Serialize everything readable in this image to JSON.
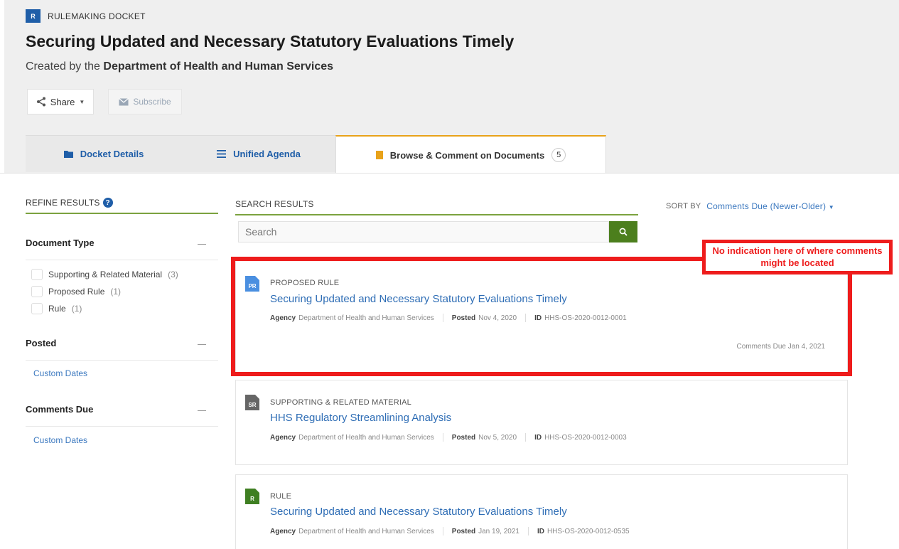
{
  "header": {
    "docket_badge": "R",
    "docket_label": "RULEMAKING DOCKET",
    "title": "Securing Updated and Necessary Statutory Evaluations Timely",
    "created_prefix": "Created by the",
    "created_by": "Department of Health and Human Services",
    "share_label": "Share",
    "subscribe_label": "Subscribe"
  },
  "tabs": [
    {
      "label": "Docket Details",
      "icon": "folder-icon"
    },
    {
      "label": "Unified Agenda",
      "icon": "list-icon"
    },
    {
      "label": "Browse & Comment on Documents",
      "icon": "document-icon",
      "count": "5",
      "active": true
    }
  ],
  "refine": {
    "title": "REFINE RESULTS",
    "document_type": {
      "heading": "Document Type",
      "options": [
        {
          "label": "Supporting & Related Material",
          "count": "(3)"
        },
        {
          "label": "Proposed Rule",
          "count": "(1)"
        },
        {
          "label": "Rule",
          "count": "(1)"
        }
      ]
    },
    "posted": {
      "heading": "Posted",
      "link": "Custom Dates"
    },
    "comments_due": {
      "heading": "Comments Due",
      "link": "Custom Dates"
    }
  },
  "search": {
    "title": "SEARCH RESULTS",
    "placeholder": "Search",
    "sort_label": "SORT BY",
    "sort_value": "Comments Due (Newer-Older)"
  },
  "results": [
    {
      "icon": "PR",
      "type": "PROPOSED RULE",
      "title": "Securing Updated and Necessary Statutory Evaluations Timely",
      "agency_label": "Agency",
      "agency": "Department of Health and Human Services",
      "posted_label": "Posted",
      "posted": "Nov 4, 2020",
      "id_label": "ID",
      "id": "HHS-OS-2020-0012-0001",
      "comments_due": "Comments Due Jan 4, 2021"
    },
    {
      "icon": "SR",
      "type": "SUPPORTING & RELATED MATERIAL",
      "title": "HHS Regulatory Streamlining Analysis",
      "agency_label": "Agency",
      "agency": "Department of Health and Human Services",
      "posted_label": "Posted",
      "posted": "Nov 5, 2020",
      "id_label": "ID",
      "id": "HHS-OS-2020-0012-0003"
    },
    {
      "icon": "R",
      "type": "RULE",
      "title": "Securing Updated and Necessary Statutory Evaluations Timely",
      "agency_label": "Agency",
      "agency": "Department of Health and Human Services",
      "posted_label": "Posted",
      "posted": "Jan 19, 2021",
      "id_label": "ID",
      "id": "HHS-OS-2020-0012-0535"
    }
  ],
  "annotation": {
    "text": "No indication here of where comments might be located"
  },
  "colors": {
    "brand_blue": "#1f5ea8",
    "link_blue": "#2e6db5",
    "accent_green": "#7ba23f",
    "button_green": "#4c7f1d",
    "tab_active_orange": "#e8a21a",
    "annotation_red": "#ee1c1c",
    "icon_pr": "#4a8fe0",
    "icon_sr": "#666666",
    "icon_r": "#3f7f22"
  }
}
